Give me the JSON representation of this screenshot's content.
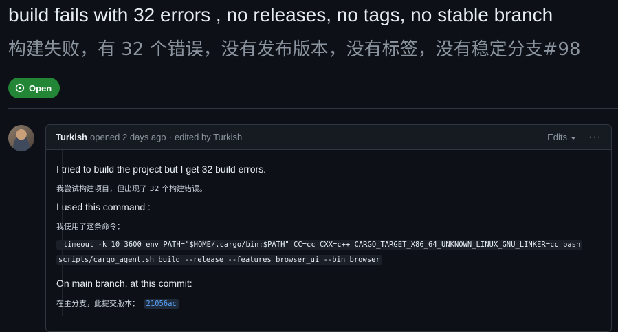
{
  "issue": {
    "title": "build fails with 32 errors , no releases, no tags, no stable branch",
    "title_translation": "构建失败，有 32 个错误，没有发布版本，没有标签，没有稳定分支",
    "number": "#98",
    "state_label": "Open"
  },
  "comment": {
    "author": "Turkish",
    "opened_text": "opened 2 days ago",
    "separator": "·",
    "edited_text": "edited by Turkish",
    "edits_label": "Edits",
    "more_label": "···",
    "line1": "I tried to build the project but I get 32 build errors.",
    "line1_zh": "我尝试构建项目，但出现了 32 个构建错误。",
    "line2": "I used this command :",
    "line2_zh": "我使用了这条命令：",
    "code_line1": "timeout -k 10 3600 env PATH=\"$HOME/.cargo/bin:$PATH\" CC=cc CXX=c++ CARGO_TARGET_X86_64_UNKNOWN_LINUX_GNU_LINKER=cc bash",
    "code_line2": "scripts/cargo_agent.sh build --release --features browser_ui --bin browser",
    "line3": "On main branch, at this commit:",
    "line3_zh": "在主分支，此提交版本：",
    "commit_sha": "21056ac"
  },
  "colors": {
    "background": "#0d1117",
    "open_badge": "#238636",
    "link": "#58a6ff"
  }
}
